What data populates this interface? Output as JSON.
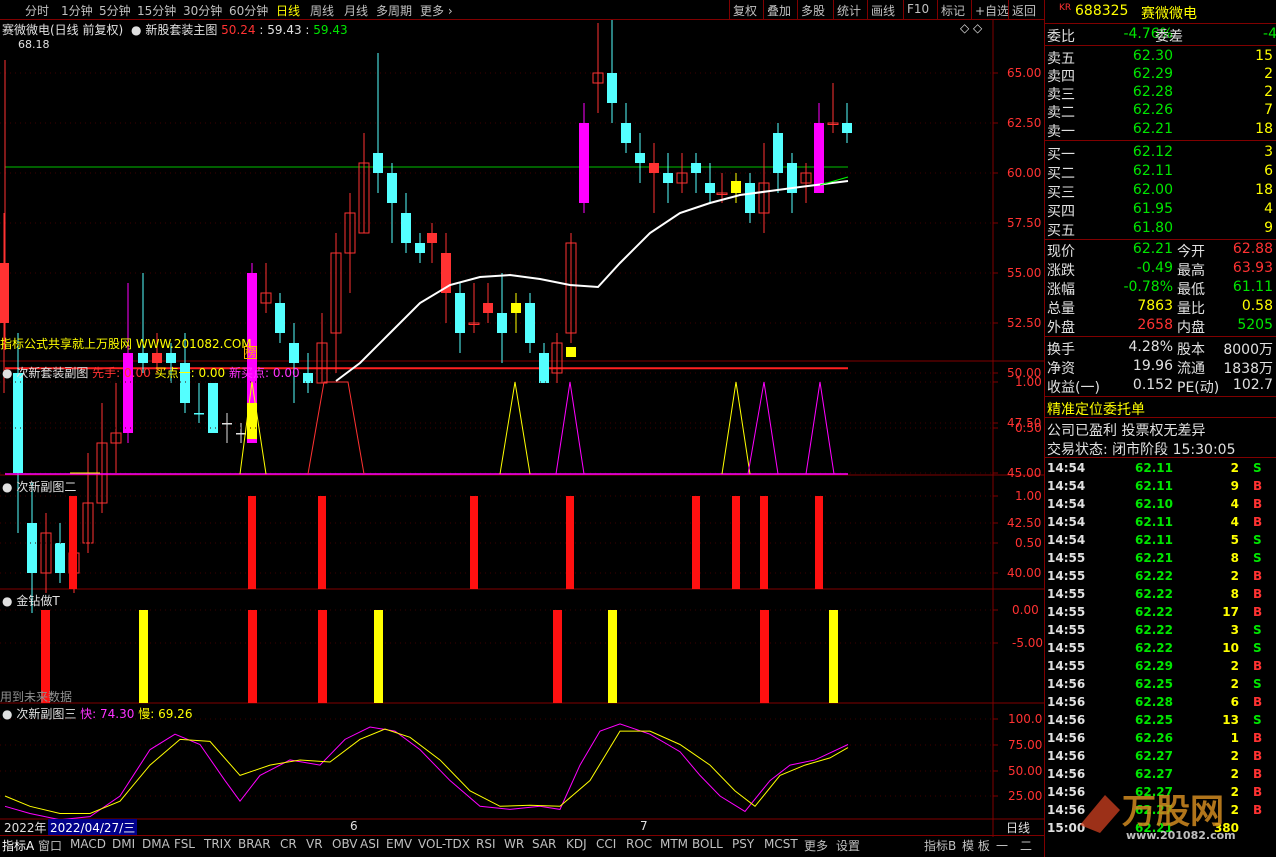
{
  "toolbar": {
    "left": [
      "分时",
      "1分钟",
      "5分钟",
      "15分钟",
      "30分钟",
      "60分钟",
      "日线",
      "周线",
      "月线",
      "多周期",
      "更多"
    ],
    "active": "日线",
    "right": [
      "复权",
      "叠加",
      "多股",
      "统计",
      "画线",
      "F10",
      "标记",
      "+自选",
      "返回"
    ]
  },
  "main_header": {
    "stock_title": "赛微微电(日线 前复权)",
    "indicator_name": "新股套装主图",
    "v1": "50.24",
    "v2": "59.43",
    "v3": "59.43",
    "high_marker": "68.18",
    "watermark_text": "指标公式共享就上万股网 WWW.201082.COM",
    "badge": "榜"
  },
  "main_axis": [
    "65.00",
    "62.50",
    "60.00",
    "57.50",
    "55.00",
    "52.50",
    "50.00",
    "47.50",
    "45.00",
    "42.50",
    "40.00"
  ],
  "sub1": {
    "name": "次新套装副图",
    "l1": "先手",
    "v1": "0.00",
    "l2": "买点一",
    "v2": "0.00",
    "l3": "新买点",
    "v3": "0.00",
    "axis": [
      "1.00",
      "0.50"
    ]
  },
  "sub2": {
    "name": "次新副图二",
    "axis": [
      "1.00",
      "0.50"
    ]
  },
  "sub3": {
    "name": "金钻做T",
    "note": "用到未来数据",
    "axis": [
      "0.00",
      "-5.00"
    ]
  },
  "sub4": {
    "name": "次新副图三",
    "l1": "快",
    "v1": "74.30",
    "l2": "慢",
    "v2": "69.26",
    "axis": [
      "100.0",
      "75.00",
      "50.00",
      "25.00"
    ]
  },
  "datebar": {
    "year": "2022年",
    "date": "2022/04/27/三",
    "m6": "6",
    "m7": "7",
    "period": "日线"
  },
  "bottom_tabs": [
    "指标A",
    "窗口",
    "MACD",
    "DMI",
    "DMA",
    "FSL",
    "TRIX",
    "BRAR",
    "CR",
    "VR",
    "OBV",
    "ASI",
    "EMV",
    "VOL-TDX",
    "RSI",
    "WR",
    "SAR",
    "KDJ",
    "CCI",
    "ROC",
    "MTM",
    "BOLL",
    "PSY",
    "MCST",
    "更多",
    "设置"
  ],
  "bottom_right": [
    "指标B",
    "模 板",
    "一",
    "二"
  ],
  "quote": {
    "market": "KR",
    "code": "688325",
    "name": "赛微微电",
    "weibi_label": "委比",
    "weibi": "-4.76%",
    "weicha_label": "委差",
    "weicha": "-4",
    "asks": [
      {
        "label": "卖五",
        "price": "62.30",
        "vol": "15"
      },
      {
        "label": "卖四",
        "price": "62.29",
        "vol": "2"
      },
      {
        "label": "卖三",
        "price": "62.28",
        "vol": "2"
      },
      {
        "label": "卖二",
        "price": "62.26",
        "vol": "7"
      },
      {
        "label": "卖一",
        "price": "62.21",
        "vol": "18"
      }
    ],
    "bids": [
      {
        "label": "买一",
        "price": "62.12",
        "vol": "3"
      },
      {
        "label": "买二",
        "price": "62.11",
        "vol": "6"
      },
      {
        "label": "买三",
        "price": "62.00",
        "vol": "18"
      },
      {
        "label": "买四",
        "price": "61.95",
        "vol": "4"
      },
      {
        "label": "买五",
        "price": "61.80",
        "vol": "9"
      }
    ],
    "stats": [
      {
        "l1": "现价",
        "v1": "62.21",
        "l2": "今开",
        "v2": "62.88"
      },
      {
        "l1": "涨跌",
        "v1": "-0.49",
        "l2": "最高",
        "v2": "63.93"
      },
      {
        "l1": "涨幅",
        "v1": "-0.78%",
        "l2": "最低",
        "v2": "61.11"
      },
      {
        "l1": "总量",
        "v1": "7863",
        "l2": "量比",
        "v2": "0.58"
      },
      {
        "l1": "外盘",
        "v1": "2658",
        "l2": "内盘",
        "v2": "5205"
      }
    ],
    "stats2": [
      {
        "l1": "换手",
        "v1": "4.28%",
        "l2": "股本",
        "v2": "8000万"
      },
      {
        "l1": "净资",
        "v1": "19.96",
        "l2": "流通",
        "v2": "1838万"
      },
      {
        "l1": "收益(一)",
        "v1": "0.152",
        "l2": "PE(动)",
        "v2": "102.7"
      }
    ],
    "info1": "精准定位委托单",
    "info2": "公司已盈利 投票权无差异",
    "info3": "交易状态: 闭市阶段 15:30:05"
  },
  "ticks": [
    {
      "t": "14:54",
      "p": "62.11",
      "v": "2",
      "s": "S"
    },
    {
      "t": "14:54",
      "p": "62.11",
      "v": "9",
      "s": "B"
    },
    {
      "t": "14:54",
      "p": "62.10",
      "v": "4",
      "s": "B"
    },
    {
      "t": "14:54",
      "p": "62.11",
      "v": "4",
      "s": "B"
    },
    {
      "t": "14:54",
      "p": "62.11",
      "v": "5",
      "s": "S"
    },
    {
      "t": "14:55",
      "p": "62.21",
      "v": "8",
      "s": "S"
    },
    {
      "t": "14:55",
      "p": "62.22",
      "v": "2",
      "s": "B"
    },
    {
      "t": "14:55",
      "p": "62.22",
      "v": "8",
      "s": "B"
    },
    {
      "t": "14:55",
      "p": "62.22",
      "v": "17",
      "s": "B"
    },
    {
      "t": "14:55",
      "p": "62.22",
      "v": "3",
      "s": "S"
    },
    {
      "t": "14:55",
      "p": "62.22",
      "v": "10",
      "s": "S"
    },
    {
      "t": "14:55",
      "p": "62.29",
      "v": "2",
      "s": "B"
    },
    {
      "t": "14:56",
      "p": "62.25",
      "v": "2",
      "s": "S"
    },
    {
      "t": "14:56",
      "p": "62.28",
      "v": "6",
      "s": "B"
    },
    {
      "t": "14:56",
      "p": "62.25",
      "v": "13",
      "s": "S"
    },
    {
      "t": "14:56",
      "p": "62.26",
      "v": "1",
      "s": "B"
    },
    {
      "t": "14:56",
      "p": "62.27",
      "v": "2",
      "s": "B"
    },
    {
      "t": "14:56",
      "p": "62.27",
      "v": "2",
      "s": "B"
    },
    {
      "t": "14:56",
      "p": "62.27",
      "v": "2",
      "s": "B"
    },
    {
      "t": "14:56",
      "p": "62.27",
      "v": "2",
      "s": "B"
    },
    {
      "t": "15:00",
      "p": "62.21",
      "v": "380",
      "s": ""
    }
  ],
  "brand": {
    "logo": "万股网",
    "url": "www.201082.com"
  }
}
